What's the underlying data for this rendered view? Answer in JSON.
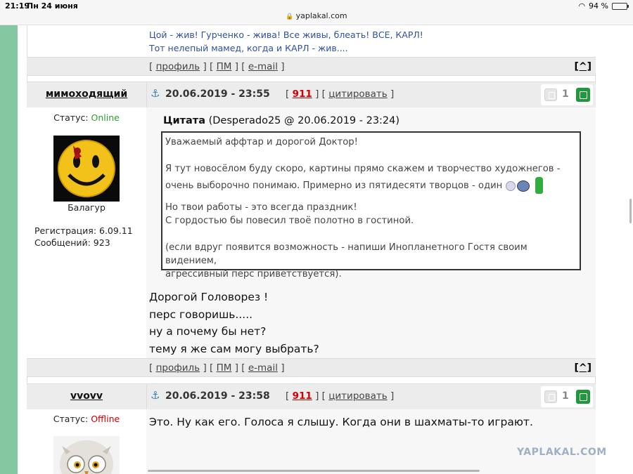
{
  "statusbar": {
    "time": "21:19",
    "date": "Пн 24 июня",
    "url": "yaplakal.com",
    "battery": "94 %"
  },
  "prev_post": {
    "signature_line1": "Цой - жив! Гурченко - жива! Все живы, блеать! ВСЕ, КАРЛ!",
    "signature_line2": "Тот нелепый мамед, когда и КАРЛ - жив...."
  },
  "footer_labels": {
    "open": "[",
    "close": "]",
    "profile": "профиль",
    "pm": "ПМ",
    "email": "e-mail",
    "up": "[^]"
  },
  "post1": {
    "author": "мимоходящий",
    "date": "20.06.2019 - 23:55",
    "rating": "911",
    "quote_label": "цитировать",
    "votes": "1",
    "status_label": "Статус:",
    "status": "Online",
    "rank": "Балагур",
    "registration": "Регистрация: 6.09.11",
    "messages": "Сообщений: 923",
    "quote_title": "Цитата",
    "quote_meta": "(Desperado25 @ 20.06.2019 - 23:24)",
    "quote_l1": "Уважаемый аффтар и дорогой Доктор!",
    "quote_l2": "Я тут новосёлом буду скоро, картины прямо скажем и творчество художнегов -",
    "quote_l3": "очень выборочно понимаю. Примерно из пятидесяти творцов - один",
    "quote_l4": "Но твои работы - это всегда праздник!",
    "quote_l5": "С гордостью бы повесил твоё полотно в гостиной.",
    "quote_l6": "(если вдруг появится возможность - напиши Инопланетного Гостя своим видением,",
    "quote_l7": "агрессивный перс приветствуется).",
    "text_l1": "Дорогой Головорез !",
    "text_l2": "перс говоришь.....",
    "text_l3": "ну а почему бы нет?",
    "text_l4": "тему я же сам могу выбрать?"
  },
  "post2": {
    "author": "vvovv",
    "date": "20.06.2019 - 23:58",
    "rating": "911",
    "quote_label": "цитировать",
    "votes": "1",
    "status_label": "Статус:",
    "status": "Offline",
    "text_l1": "Это. Ну как его. Голоса я слышу. Когда они в шахматы-то играют."
  },
  "watermark": "YAPLAKAL.COM"
}
